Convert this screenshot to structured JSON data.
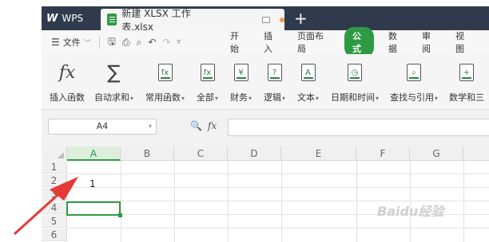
{
  "titlebar": {
    "app_label": "WPS",
    "doc_tab": "新建 XLSX 工作表.xlsx",
    "new_tab": "+"
  },
  "menu": {
    "file_label": "文件",
    "tabs": [
      "开始",
      "插入",
      "页面布局",
      "公式",
      "数据",
      "审阅",
      "视图"
    ],
    "active_tab": "公式"
  },
  "ribbon": {
    "buttons": [
      {
        "label": "插入函数",
        "icon": "fx-icon",
        "glyph": "fx"
      },
      {
        "label": "自动求和",
        "icon": "sigma-icon",
        "glyph": "∑"
      },
      {
        "label": "常用函数",
        "icon": "function-book-icon",
        "glyph": "fx"
      },
      {
        "label": "全部",
        "icon": "function-book-icon",
        "glyph": "fx"
      },
      {
        "label": "财务",
        "icon": "finance-book-icon",
        "glyph": "¥"
      },
      {
        "label": "逻辑",
        "icon": "logic-book-icon",
        "glyph": "?"
      },
      {
        "label": "文本",
        "icon": "text-book-icon",
        "glyph": "A"
      },
      {
        "label": "日期和时间",
        "icon": "clock-book-icon",
        "glyph": "◷"
      },
      {
        "label": "查找与引用",
        "icon": "lookup-book-icon",
        "glyph": "⌕"
      },
      {
        "label": "数学和三",
        "icon": "math-book-icon",
        "glyph": "+"
      }
    ]
  },
  "formula_bar": {
    "name_box": "A4",
    "fx_label": "fx",
    "formula": ""
  },
  "grid": {
    "columns": [
      "A",
      "B",
      "C",
      "D",
      "E",
      "F",
      "G"
    ],
    "selected_column": "A",
    "rows": [
      "1",
      "2",
      "3",
      "4",
      "5",
      "6"
    ],
    "cells": {
      "A2": "1"
    },
    "active_cell": "A4"
  },
  "watermark": "Baidu经验",
  "colors": {
    "accent": "#2e9b44",
    "titlebar": "#2f3b4c",
    "arrow": "#e53935"
  }
}
